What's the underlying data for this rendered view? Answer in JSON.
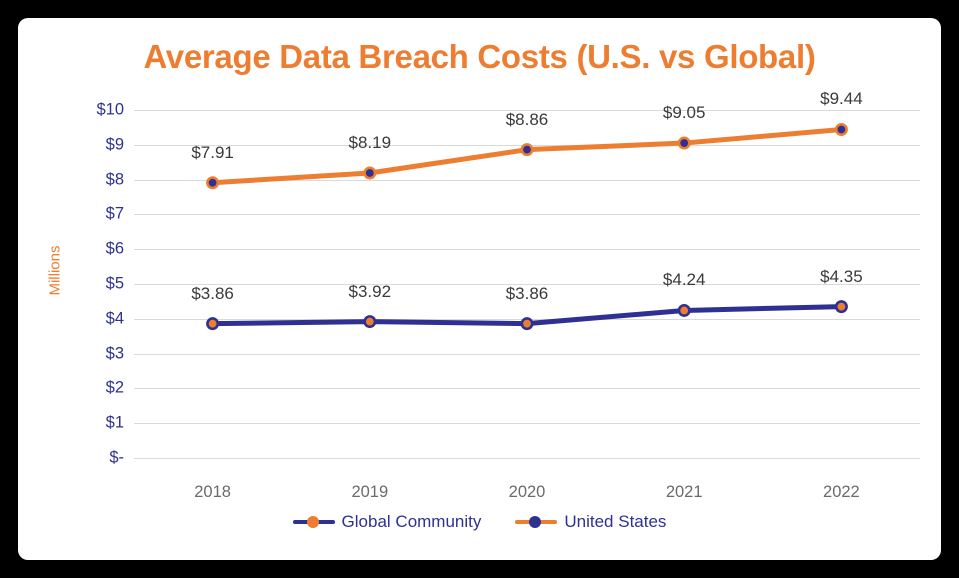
{
  "chart_data": {
    "type": "line",
    "title": "Average Data Breach Costs (U.S. vs Global)",
    "xlabel": "",
    "ylabel": "Millions",
    "categories": [
      "2018",
      "2019",
      "2020",
      "2021",
      "2022"
    ],
    "ylim": [
      0,
      10
    ],
    "ytick_labels": [
      "$10",
      "$9",
      "$8",
      "$7",
      "$6",
      "$5",
      "$4",
      "$3",
      "$2",
      "$1",
      "$-"
    ],
    "ytick_values": [
      10,
      9,
      8,
      7,
      6,
      5,
      4,
      3,
      2,
      1,
      0
    ],
    "grid": true,
    "legend_position": "bottom",
    "series": [
      {
        "name": "Global Community",
        "values": [
          3.86,
          3.92,
          3.86,
          4.24,
          4.35
        ],
        "data_labels": [
          "$3.86",
          "$3.92",
          "$3.86",
          "$4.24",
          "$4.35"
        ],
        "line_color": "#2E3192",
        "marker_fill": "#ED7D31",
        "marker_stroke": "#2E3192"
      },
      {
        "name": "United States",
        "values": [
          7.91,
          8.19,
          8.86,
          9.05,
          9.44
        ],
        "data_labels": [
          "$7.91",
          "$8.19",
          "$8.86",
          "$9.05",
          "$9.44"
        ],
        "line_color": "#ED7D31",
        "marker_fill": "#2E3192",
        "marker_stroke": "#ED7D31"
      }
    ],
    "colors": {
      "title": "#ED7D31",
      "axis_title": "#ED7D31",
      "ytick": "#2E3192",
      "xtick": "#6b6b6b",
      "datalabel": "#3a3a3a",
      "gridline": "#d9d9d9",
      "background": "#ffffff",
      "border": "#000000"
    }
  }
}
